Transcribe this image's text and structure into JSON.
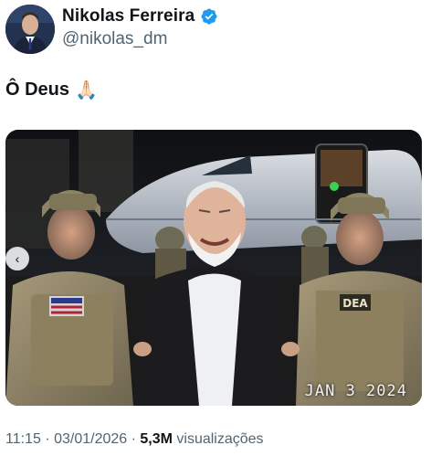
{
  "post": {
    "author": {
      "display_name": "Nikolas Ferreira",
      "handle": "@nikolas_dm",
      "verified_color": "#1d9bf0"
    },
    "text": "Ô Deus",
    "emoji": "🙏🏻",
    "media": {
      "stamp": "JAN  3 2024",
      "patch_label": "DEA"
    },
    "meta": {
      "time": "11:15",
      "separator1": " · ",
      "date": "03/01/2026",
      "separator2": " · ",
      "views_count": "5,3M",
      "views_label": " visualizações"
    }
  },
  "icons": {
    "verified": "verified-badge-icon",
    "carousel_prev": "chevron-left-icon"
  }
}
